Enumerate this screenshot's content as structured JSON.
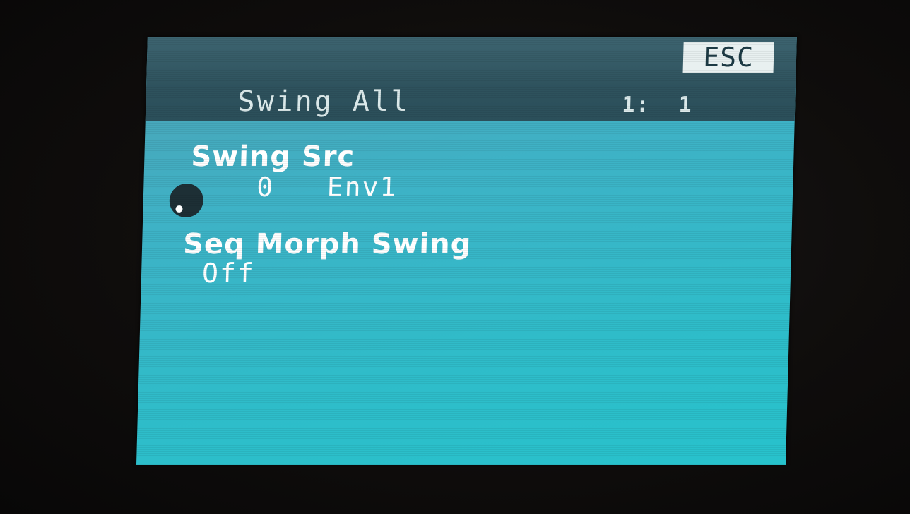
{
  "header": {
    "title": "Swing All",
    "position": "1:  1",
    "esc_label": "ESC"
  },
  "params": [
    {
      "label": "Swing Src",
      "value": "0   Env1"
    },
    {
      "label": "Seq Morph Swing",
      "value": "Off"
    }
  ],
  "icons": {
    "knob": "knob-icon"
  },
  "colors": {
    "screen": "#3eb2c6",
    "title_bar": "#2e525d",
    "text": "#ffffff",
    "esc_bg": "#e8f0f0"
  }
}
